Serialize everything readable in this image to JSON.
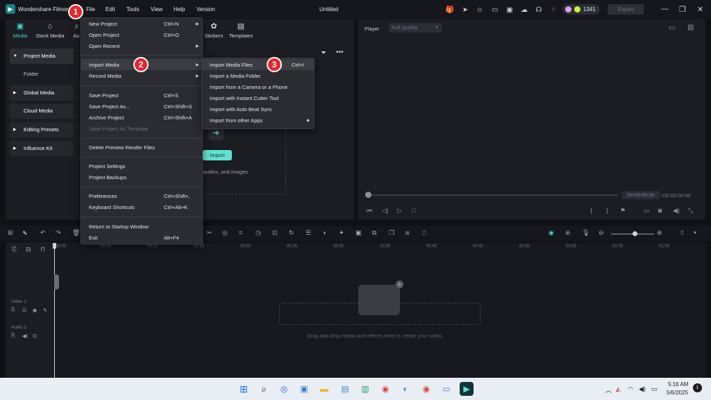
{
  "app": {
    "name": "Wondershare Filmora",
    "document_title": "Untitled",
    "credits": "1341",
    "export_label": "Export"
  },
  "menubar": [
    "File",
    "Edit",
    "Tools",
    "View",
    "Help",
    "Version"
  ],
  "media_tabs": [
    {
      "label": "Media",
      "icon": "media-icon",
      "active": true
    },
    {
      "label": "Stock Media",
      "icon": "stock-media-icon"
    },
    {
      "label": "Au",
      "icon": "audio-icon"
    },
    {
      "label": "Stickers",
      "icon": "stickers-icon"
    },
    {
      "label": "Templates",
      "icon": "templates-icon"
    }
  ],
  "media_sidebar": [
    {
      "label": "Project Media",
      "arrow": true,
      "selected": true
    },
    {
      "label": "Folder"
    },
    {
      "label": "Global Media",
      "arrow": true
    },
    {
      "label": "Cloud Media"
    },
    {
      "label": "Editing Presets",
      "arrow": true
    },
    {
      "label": "Influence Kit",
      "arrow": true
    }
  ],
  "media_area": {
    "import_label": "Import",
    "hint": "audios, and images"
  },
  "player": {
    "label": "Player",
    "quality": "Full Quality",
    "time_current": "00:00:00:00",
    "time_separator": "/",
    "time_total": "00:00:00:00"
  },
  "file_menu": {
    "items": [
      {
        "label": "New Project",
        "shortcut": "Ctrl+N",
        "submenu": true
      },
      {
        "label": "Open Project",
        "shortcut": "Ctrl+O"
      },
      {
        "label": "Open Recent",
        "submenu": true
      },
      {
        "label": "Import Media",
        "submenu": true,
        "highlighted": true
      },
      {
        "label": "Record Media",
        "submenu": true
      },
      {
        "label": "Save Project",
        "shortcut": "Ctrl+S"
      },
      {
        "label": "Save Project As...",
        "shortcut": "Ctrl+Shift+S"
      },
      {
        "label": "Archive Project",
        "shortcut": "Ctrl+Shift+A"
      },
      {
        "label": "Save Project As Template",
        "disabled": true
      },
      {
        "label": "Delete Preview Render Files"
      },
      {
        "label": "Project Settings"
      },
      {
        "label": "Project Backups"
      },
      {
        "label": "Preferences",
        "shortcut": "Ctrl+Shift+,"
      },
      {
        "label": "Keyboard Shortcuts",
        "shortcut": "Ctrl+Alt+K"
      },
      {
        "label": "Return to Startup Window"
      },
      {
        "label": "Exit",
        "shortcut": "Alt+F4"
      }
    ]
  },
  "import_submenu": {
    "items": [
      {
        "label": "Import Media Files",
        "shortcut": "Ctrl+I",
        "highlighted": true
      },
      {
        "label": "Import a Media Folder"
      },
      {
        "label": "Import from a Camera or a Phone"
      },
      {
        "label": "Import with Instant Cutter Tool"
      },
      {
        "label": "Import with Auto Beat Sync"
      },
      {
        "label": "Import from other Apps",
        "submenu": true
      }
    ]
  },
  "step_badges": [
    "1",
    "2",
    "3"
  ],
  "timeline": {
    "ruler": [
      "00:00",
      "00:05",
      "00:10",
      "00:15",
      "00:20",
      "00:25",
      "00:30",
      "00:35",
      "00:40",
      "00:45",
      "00:50",
      "00:55",
      "01:00",
      "01:05"
    ],
    "video_track": "Video 1",
    "audio_track": "Audio 1",
    "drop_hint": "Drag and drop media and effects here to create your video."
  },
  "taskbar": {
    "time": "5:16 AM",
    "date": "5/6/2025",
    "notifications": "1"
  },
  "colors": {
    "accent": "#3bd7c5",
    "badge": "#e8262b"
  }
}
